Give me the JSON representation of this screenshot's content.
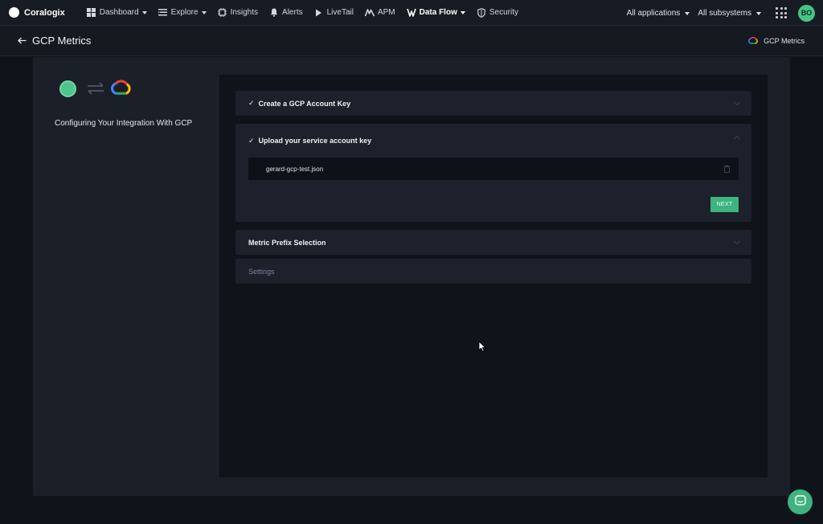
{
  "brand": {
    "name": "Coralogix"
  },
  "nav": {
    "items": [
      {
        "label": "Dashboard",
        "icon": "dashboard-icon",
        "dropdown": true
      },
      {
        "label": "Explore",
        "icon": "explore-icon",
        "dropdown": true
      },
      {
        "label": "Insights",
        "icon": "insights-icon",
        "dropdown": false
      },
      {
        "label": "Alerts",
        "icon": "bell-icon",
        "dropdown": false
      },
      {
        "label": "LiveTail",
        "icon": "play-icon",
        "dropdown": false
      },
      {
        "label": "APM",
        "icon": "apm-icon",
        "dropdown": false
      },
      {
        "label": "Data Flow",
        "icon": "data-flow-icon",
        "dropdown": true,
        "active": true
      },
      {
        "label": "Security",
        "icon": "shield-icon",
        "dropdown": false
      }
    ],
    "applications_label": "All applications",
    "subsystems_label": "All subsystems",
    "avatar_initials": "BO"
  },
  "header": {
    "title": "GCP Metrics",
    "integration_label": "GCP Metrics"
  },
  "left": {
    "config_title": "Configuring Your Integration With GCP"
  },
  "steps": [
    {
      "title": "Create a GCP Account Key",
      "completed": true,
      "expanded": false
    },
    {
      "title": "Upload your service account key",
      "completed": true,
      "expanded": true,
      "file_name": "gerard-gcp-test.json",
      "next_label": "NEXT"
    },
    {
      "title": "Metric Prefix Selection",
      "completed": false,
      "expanded": false
    },
    {
      "title": "Settings",
      "completed": false,
      "expanded": false,
      "disabled": true
    }
  ],
  "colors": {
    "accent": "#3fb37f",
    "background": "#0f131a",
    "panel": "#1a1f28",
    "card": "#1c212b"
  }
}
